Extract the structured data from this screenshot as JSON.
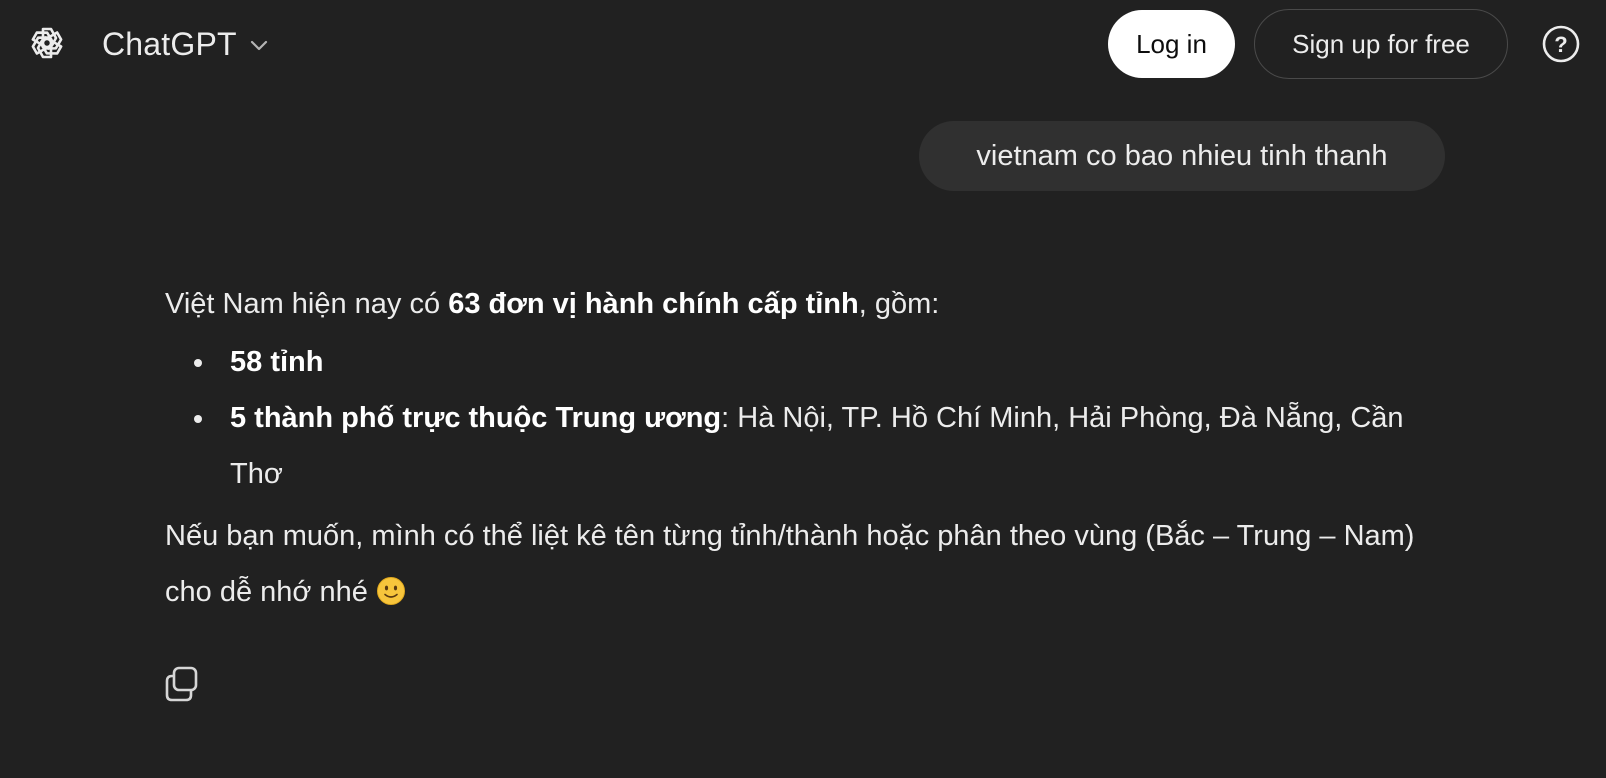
{
  "header": {
    "model_name": "ChatGPT",
    "login_label": "Log in",
    "signup_label": "Sign up for free",
    "help_label": "?"
  },
  "conversation": {
    "user_message": "vietnam co bao nhieu tinh thanh",
    "assistant": {
      "intro_prefix": "Việt Nam hiện nay có ",
      "intro_bold": "63 đơn vị hành chính cấp tỉnh",
      "intro_suffix": ", gồm:",
      "items": [
        {
          "bold": "58 tỉnh",
          "text": ""
        },
        {
          "bold": "5 thành phố trực thuộc Trung ương",
          "text": ": Hà Nội, TP. Hồ Chí Minh, Hải Phòng, Đà Nẵng, Cần Thơ"
        }
      ],
      "outro": "Nếu bạn muốn, mình có thể liệt kê tên từng tỉnh/thành hoặc phân theo vùng (Bắc – Trung – Nam) cho dễ nhớ nhé",
      "emoji": "slightly-smiling-face"
    }
  },
  "icons": {
    "logo": "openai-logo-icon",
    "chevron": "chevron-down-icon",
    "help": "question-circle-icon",
    "copy": "copy-icon"
  }
}
